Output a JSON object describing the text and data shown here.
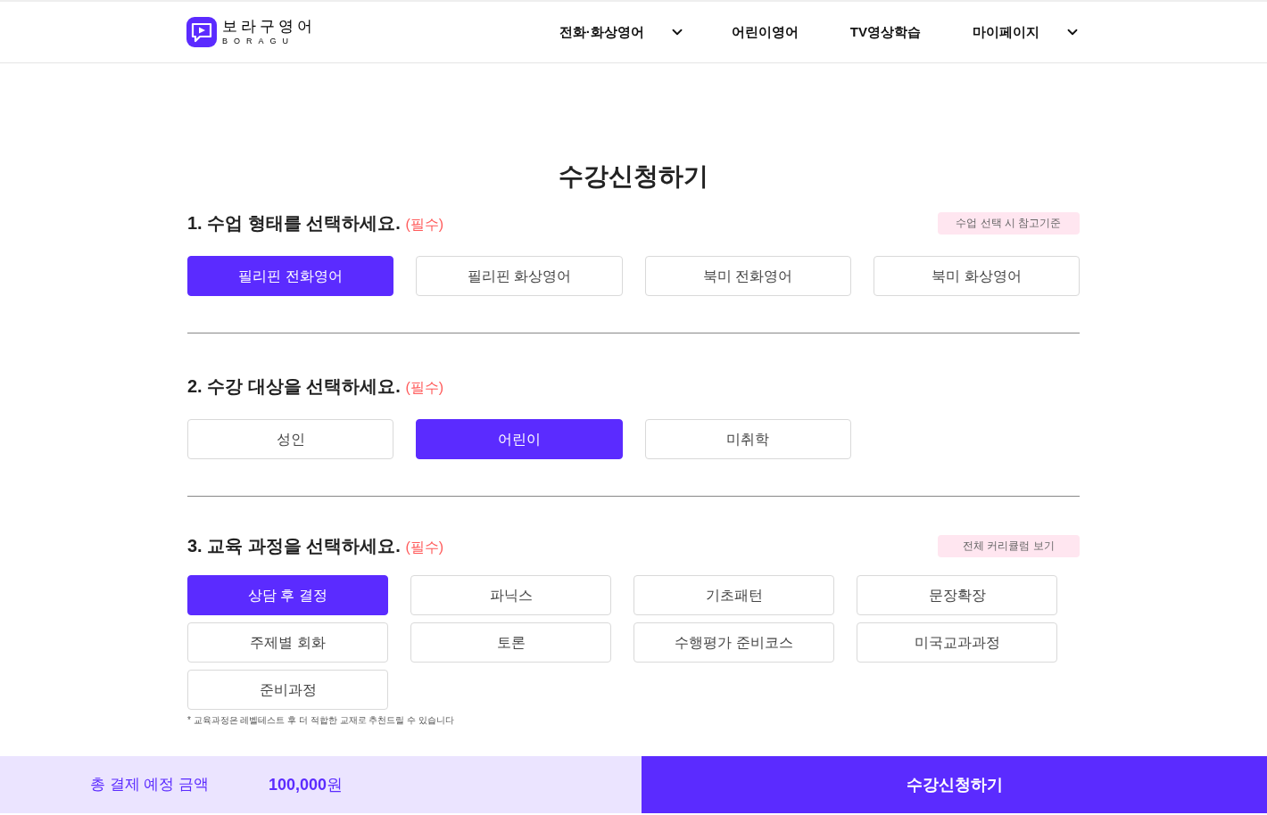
{
  "logo": {
    "name": "보라구영어",
    "subtitle": "BORAGU"
  },
  "nav": [
    {
      "label": "전화·화상영어",
      "dropdown": true
    },
    {
      "label": "어린이영어",
      "dropdown": false
    },
    {
      "label": "TV영상학습",
      "dropdown": false
    },
    {
      "label": "마이페이지",
      "dropdown": true
    }
  ],
  "title": "수강신청하기",
  "sections": [
    {
      "heading": "1. 수업 형태를 선택하세요.",
      "required": "(필수)",
      "link": "수업 선택 시 참고기준",
      "options": [
        {
          "label": "필리핀 전화영어",
          "selected": true
        },
        {
          "label": "필리핀 화상영어",
          "selected": false
        },
        {
          "label": "북미 전화영어",
          "selected": false
        },
        {
          "label": "북미 화상영어",
          "selected": false
        }
      ]
    },
    {
      "heading": "2. 수강 대상을 선택하세요.",
      "required": "(필수)",
      "options": [
        {
          "label": "성인",
          "selected": false
        },
        {
          "label": "어린이",
          "selected": true
        },
        {
          "label": "미취학",
          "selected": false
        }
      ]
    },
    {
      "heading": "3. 교육 과정을 선택하세요.",
      "required": "(필수)",
      "link": "전체 커리큘럼 보기",
      "options": [
        {
          "label": "상담 후 결정",
          "selected": true
        },
        {
          "label": "파닉스",
          "selected": false
        },
        {
          "label": "기초패턴",
          "selected": false
        },
        {
          "label": "문장확장",
          "selected": false
        },
        {
          "label": "주제별 회화",
          "selected": false
        },
        {
          "label": "토론",
          "selected": false
        },
        {
          "label": "수행평가 준비코스",
          "selected": false
        },
        {
          "label": "미국교과과정",
          "selected": false
        },
        {
          "label": "준비과정",
          "selected": false
        }
      ],
      "note": "* 교육과정은 레벨테스트 후 더 적합한 교재로 추천드릴 수 있습니다"
    }
  ],
  "footer": {
    "total_label": "총 결제 예정 금액",
    "amount": "100,000",
    "unit": "원",
    "submit": "수강신청하기"
  }
}
